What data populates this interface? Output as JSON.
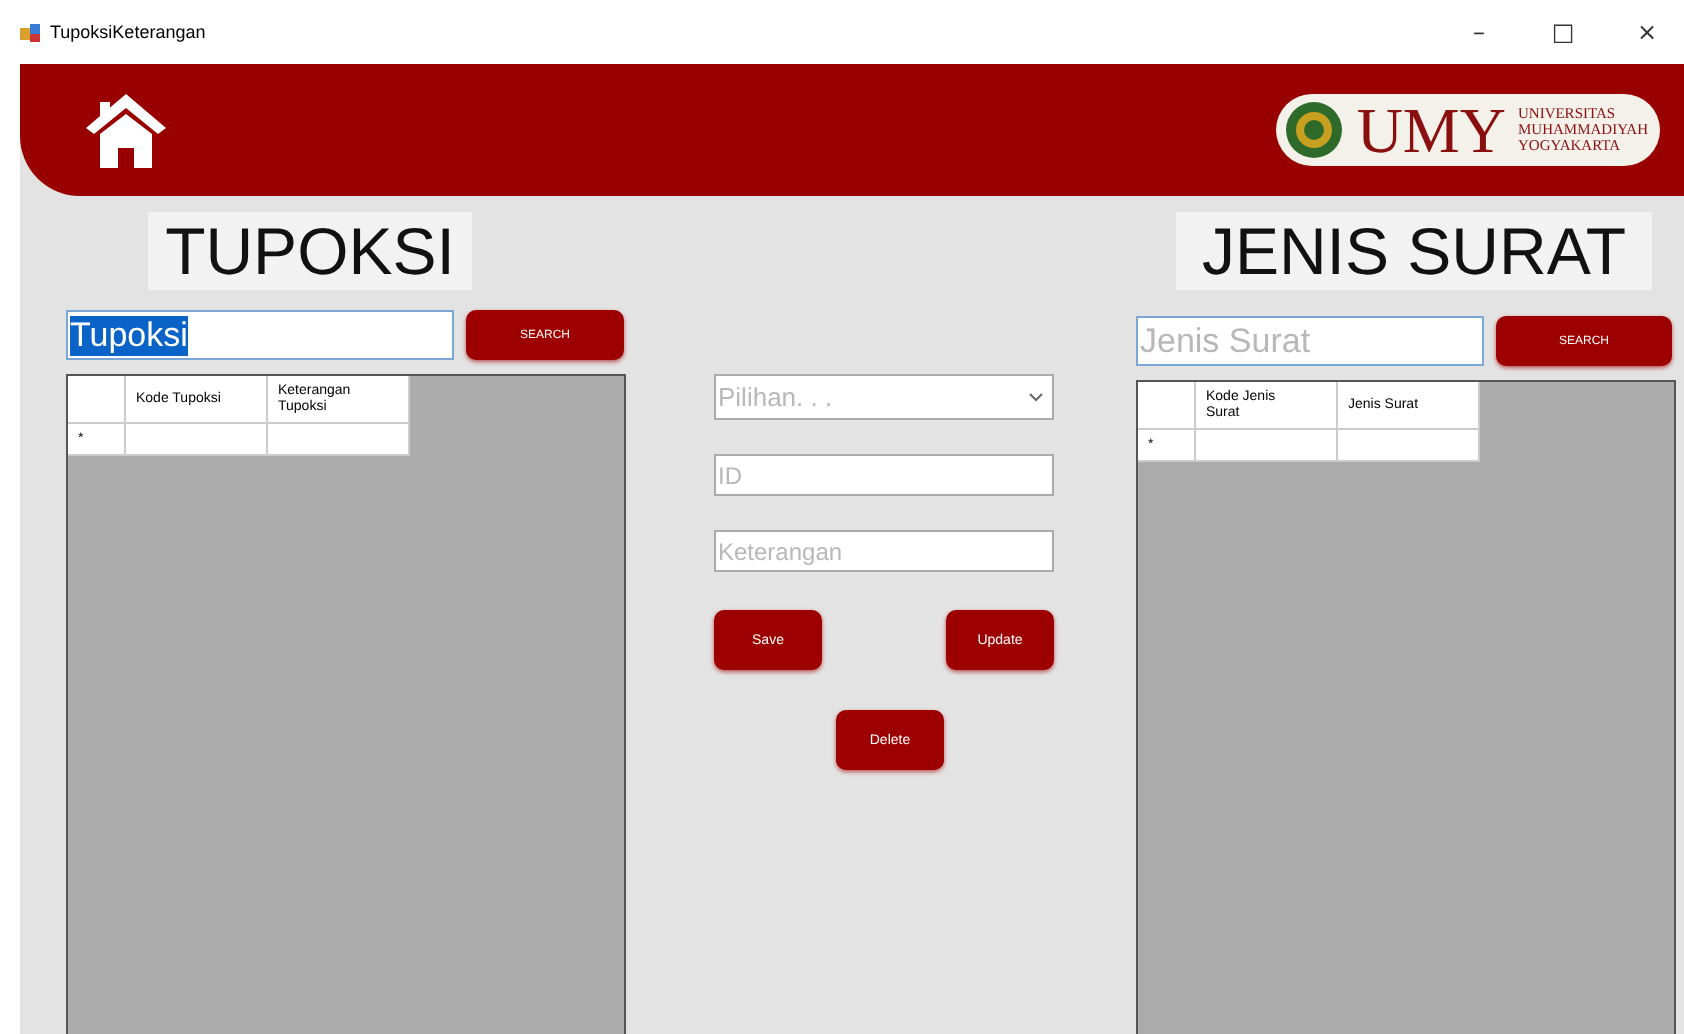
{
  "window": {
    "title": "TupoksiKeterangan",
    "controls": [
      "–",
      "□",
      "×"
    ]
  },
  "header": {
    "logo": {
      "acronym": "UMY",
      "lines": [
        "UNIVERSITAS",
        "MUHAMMADIYAH",
        "YOGYAKARTA"
      ]
    }
  },
  "left": {
    "title": "TUPOKSI",
    "search": {
      "value": "Tupoksi",
      "text_selected": true
    },
    "search_button": "SEARCH",
    "table": {
      "columns": [
        "Kode Tupoksi",
        "Keterangan Tupoksi"
      ],
      "rows": [
        {
          "marker": "*"
        }
      ]
    }
  },
  "form": {
    "dropdown": {
      "placeholder": "Pilihan. . ."
    },
    "fields": [
      {
        "placeholder": "ID"
      },
      {
        "placeholder": "Keterangan"
      }
    ],
    "buttons": [
      "Save",
      "Update",
      "Delete"
    ]
  },
  "right": {
    "title": "JENIS SURAT",
    "search": {
      "placeholder": "Jenis Surat"
    },
    "search_button": "SEARCH",
    "table": {
      "columns": [
        "Kode Jenis Surat",
        "Jenis Surat"
      ],
      "rows": [
        {
          "marker": "*"
        }
      ]
    }
  }
}
